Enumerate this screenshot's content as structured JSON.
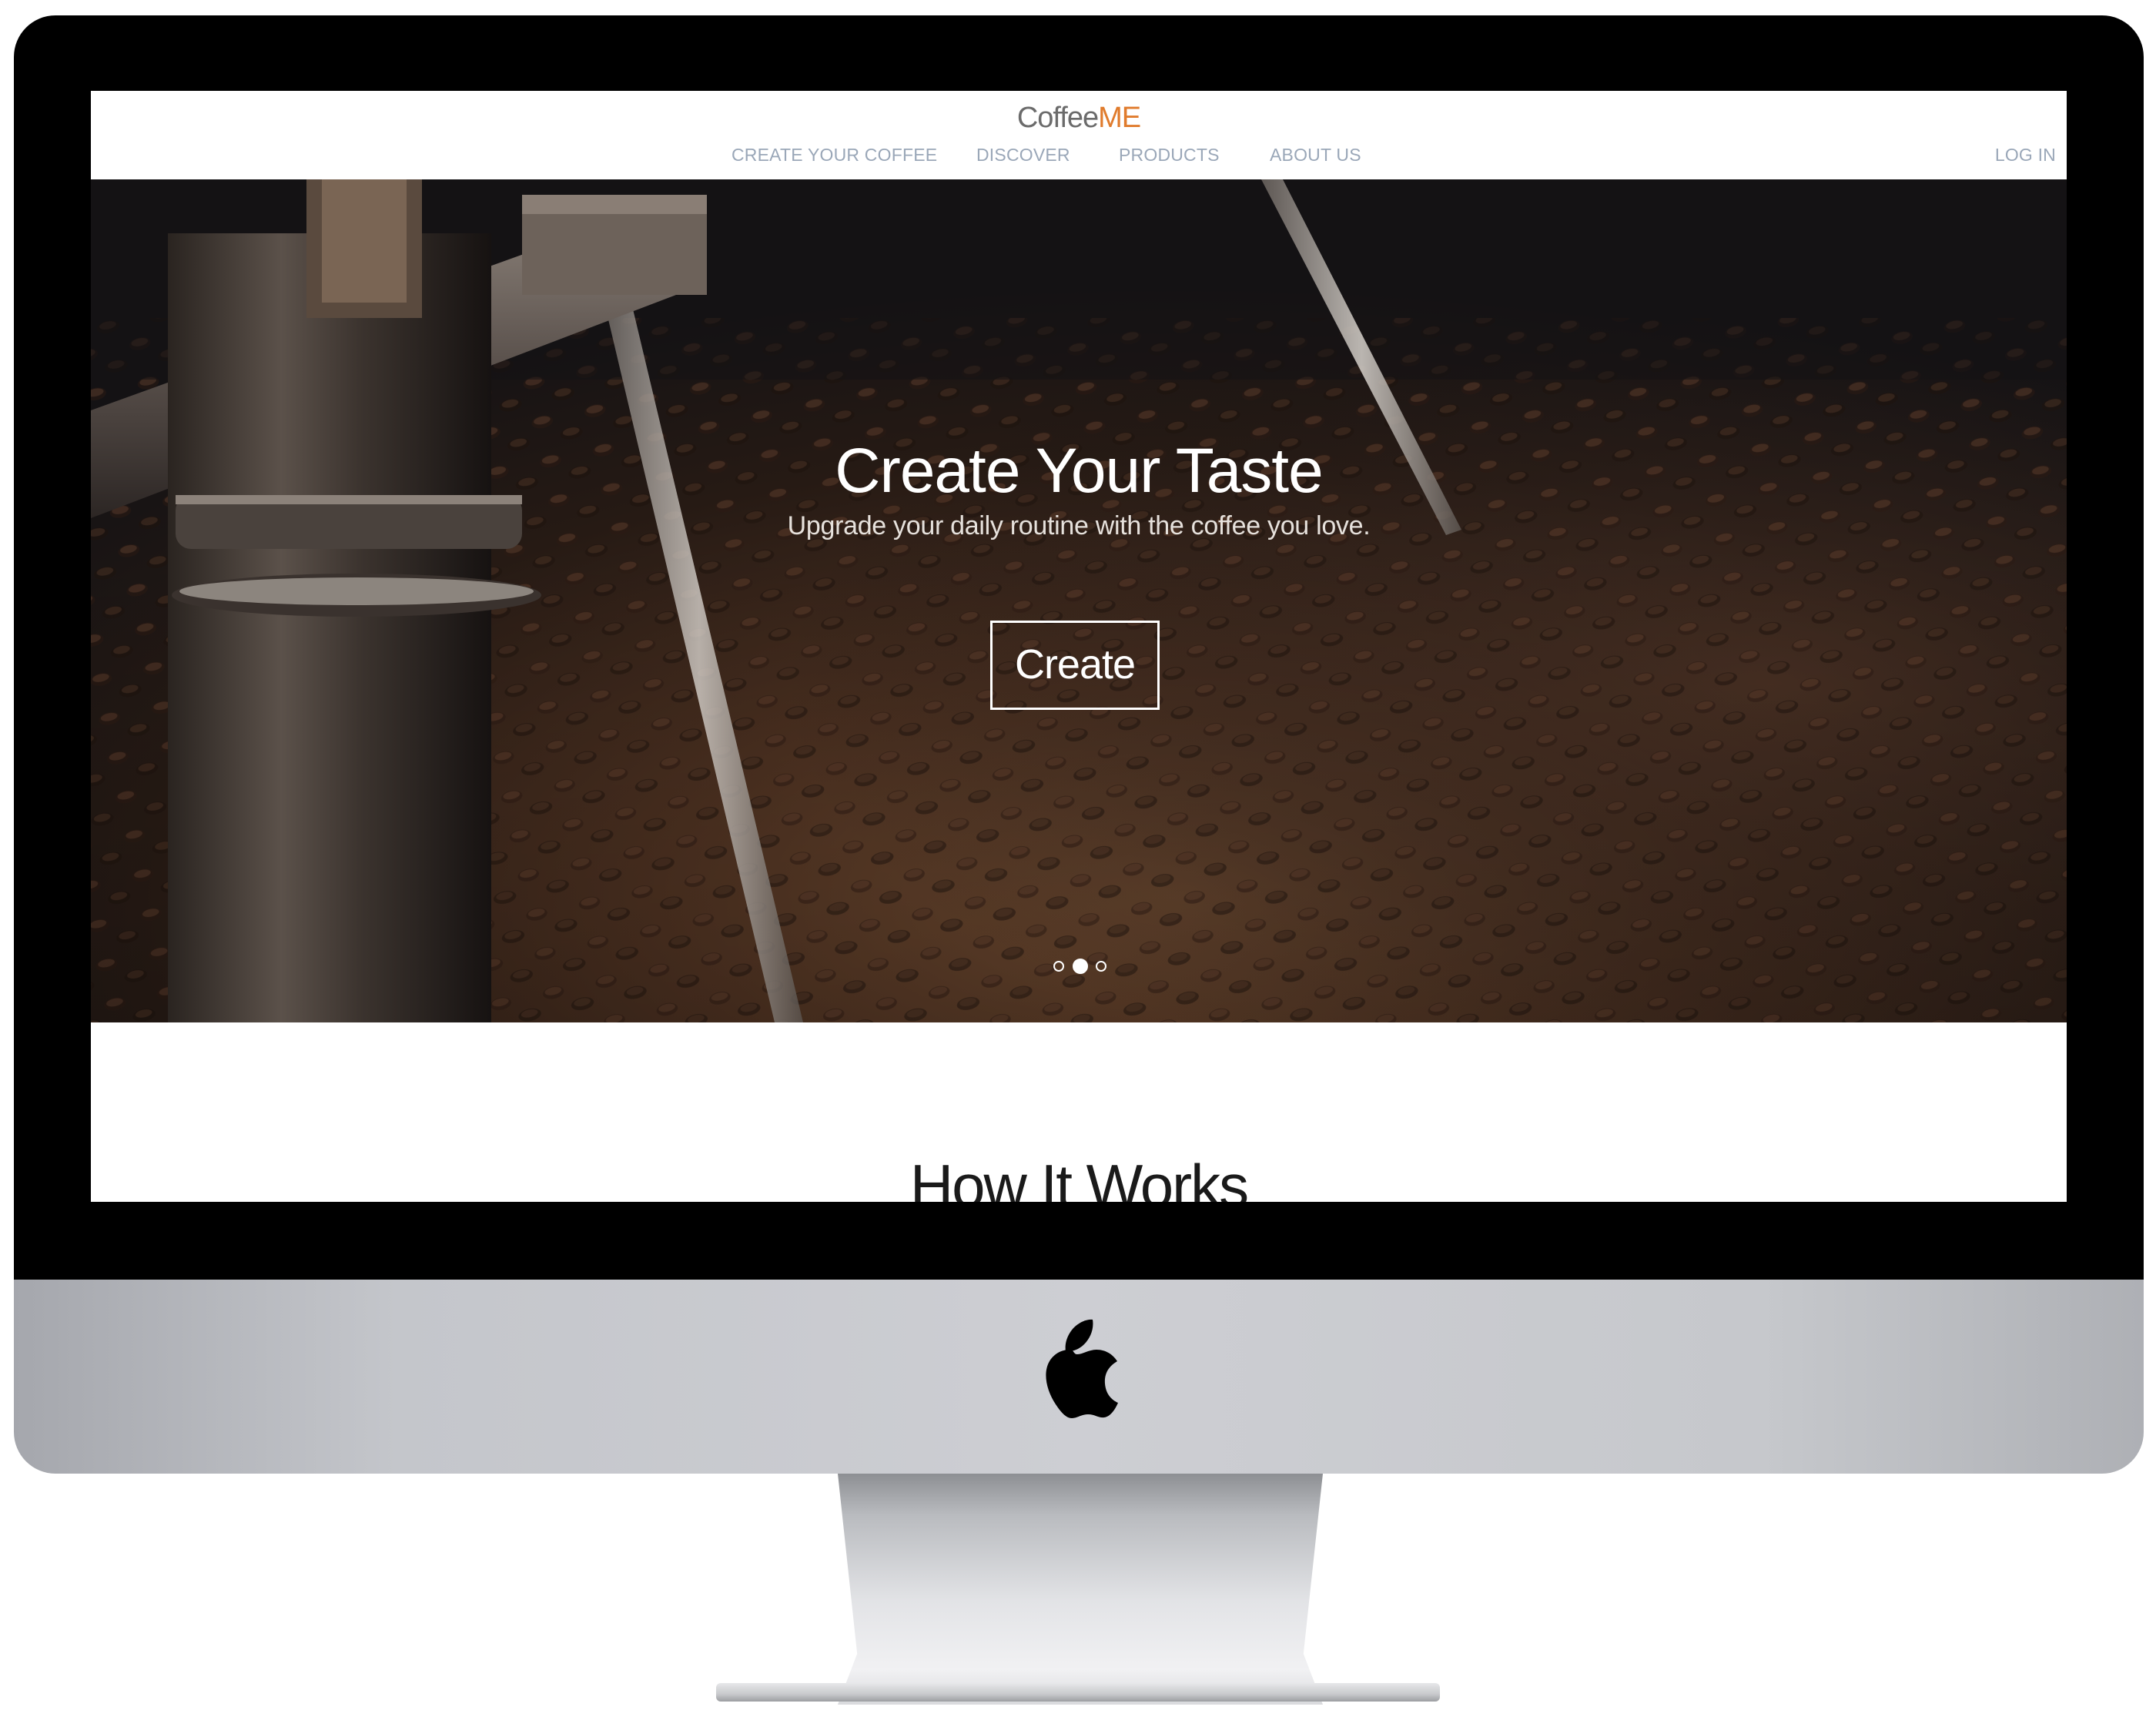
{
  "logo": {
    "prefix": "Coffee",
    "accent": "ME",
    "accent_color": "#e07b2c"
  },
  "nav": {
    "items": [
      {
        "label": "CREATE YOUR COFFEE"
      },
      {
        "label": "DISCOVER"
      },
      {
        "label": "PRODUCTS"
      },
      {
        "label": "ABOUT US"
      }
    ],
    "login_label": "LOG IN",
    "link_color": "#9aa7b8"
  },
  "hero": {
    "title": "Create Your Taste",
    "subtitle": "Upgrade your daily routine with the coffee you love.",
    "button_label": "Create",
    "background_image": "coffee beans in roaster",
    "carousel": {
      "slide_count": 3,
      "active_slide": 2
    }
  },
  "section": {
    "title": "How It Works"
  },
  "device": {
    "logo_icon": "apple-icon"
  }
}
